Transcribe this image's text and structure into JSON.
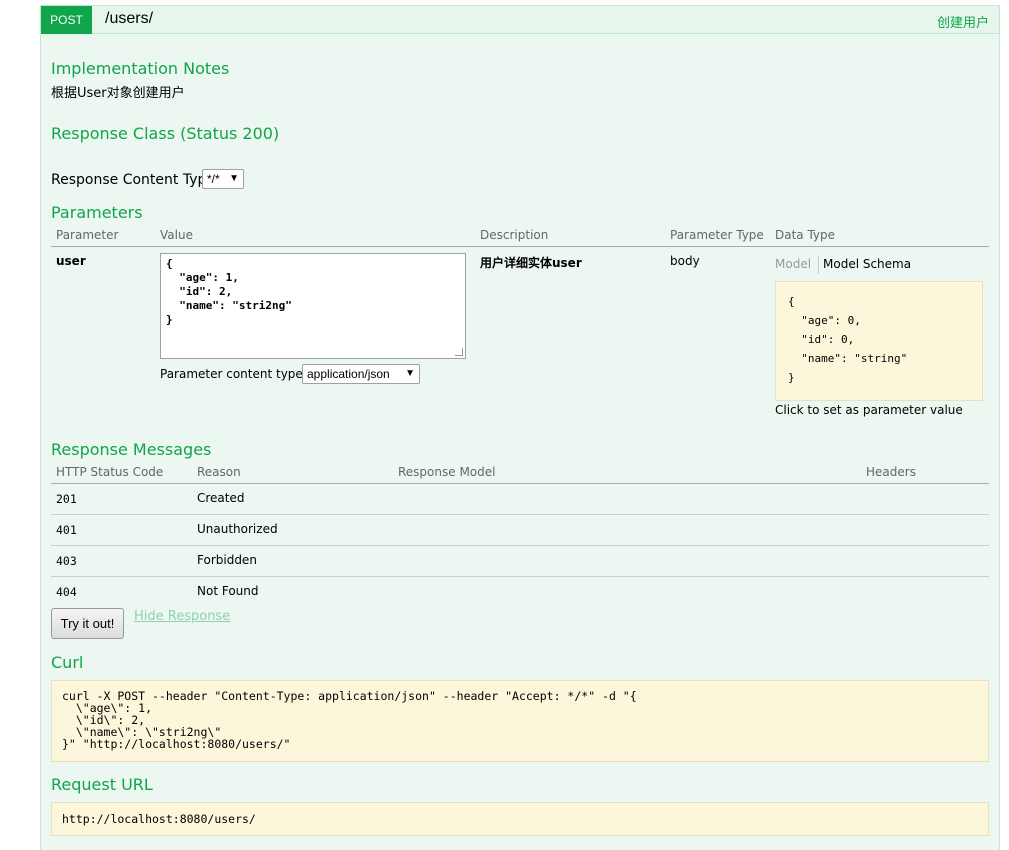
{
  "operation": {
    "method": "POST",
    "path": "/users/",
    "summary": "创建用户"
  },
  "implementation_notes": {
    "heading": "Implementation Notes",
    "text": "根据User对象创建用户"
  },
  "response_class": {
    "heading": "Response Class (Status 200)"
  },
  "response_content_type": {
    "label": "Response Content Type",
    "selected": "*/*"
  },
  "parameters": {
    "heading": "Parameters",
    "columns": [
      "Parameter",
      "Value",
      "Description",
      "Parameter Type",
      "Data Type"
    ],
    "rows": [
      {
        "name": "user",
        "value": "{\n  \"age\": 1,\n  \"id\": 2,\n  \"name\": \"stri2ng\"\n}",
        "content_type_label": "Parameter content type:",
        "content_type_selected": "application/json",
        "description": "用户详细实体user",
        "param_type": "body",
        "model_tab": "Model",
        "model_schema_tab": "Model Schema",
        "schema": "{\n  \"age\": 0,\n  \"id\": 0,\n  \"name\": \"string\"\n}",
        "schema_hint": "Click to set as parameter value"
      }
    ]
  },
  "response_messages": {
    "heading": "Response Messages",
    "columns": [
      "HTTP Status Code",
      "Reason",
      "Response Model",
      "Headers"
    ],
    "rows": [
      {
        "code": "201",
        "reason": "Created"
      },
      {
        "code": "401",
        "reason": "Unauthorized"
      },
      {
        "code": "403",
        "reason": "Forbidden"
      },
      {
        "code": "404",
        "reason": "Not Found"
      }
    ]
  },
  "actions": {
    "try_label": "Try it out!",
    "hide_label": "Hide Response"
  },
  "curl": {
    "heading": "Curl",
    "command": "curl -X POST --header \"Content-Type: application/json\" --header \"Accept: */*\" -d \"{\n  \\\"age\\\": 1,\n  \\\"id\\\": 2,\n  \\\"name\\\": \\\"stri2ng\\\"\n}\" \"http://localhost:8080/users/\""
  },
  "request_url": {
    "heading": "Request URL",
    "url": "http://localhost:8080/users/"
  },
  "colors": {
    "accent": "#10a54a",
    "panel_bg": "#ebf7f0",
    "code_bg": "#fcf6db"
  }
}
